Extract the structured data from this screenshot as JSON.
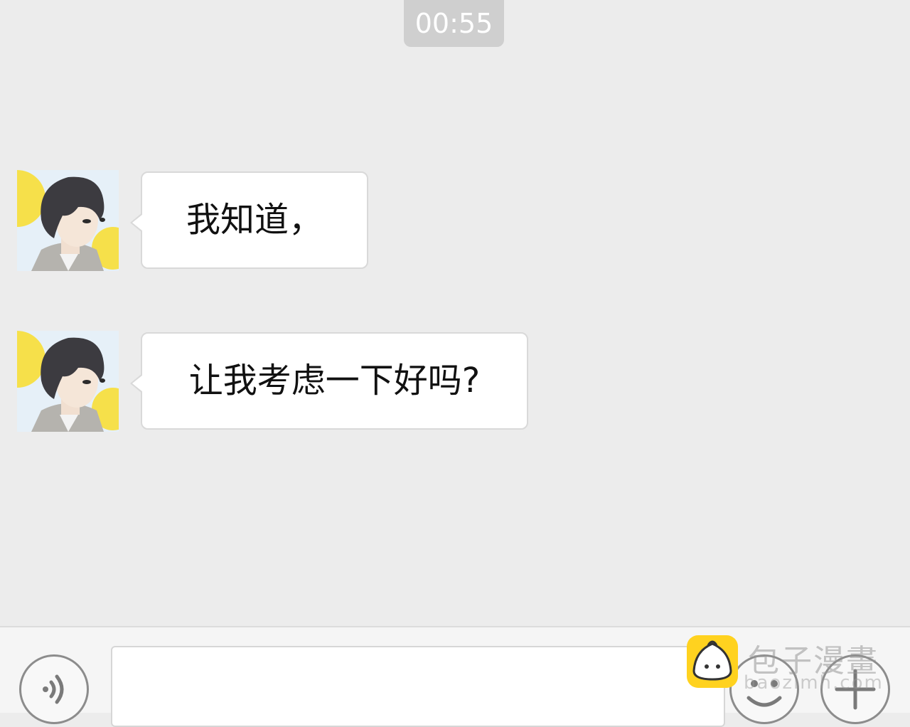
{
  "timestamp": "00:55",
  "messages": [
    {
      "sender": "contact",
      "avatar_icon": "avatar-young-man",
      "text": "我知道，"
    },
    {
      "sender": "contact",
      "avatar_icon": "avatar-young-man",
      "text": "让我考虑一下好吗?"
    }
  ],
  "input_bar": {
    "voice_icon": "voice-icon",
    "input_value": "",
    "emoji_icon": "emoji-icon",
    "plus_icon": "plus-icon"
  },
  "watermark": {
    "title": "包子漫畫",
    "url": "baozimh.com",
    "logo_color": "#ffd21f"
  },
  "colors": {
    "background": "#ececec",
    "bubble": "#ffffff",
    "timestamp_bg": "#cfcfcf"
  }
}
